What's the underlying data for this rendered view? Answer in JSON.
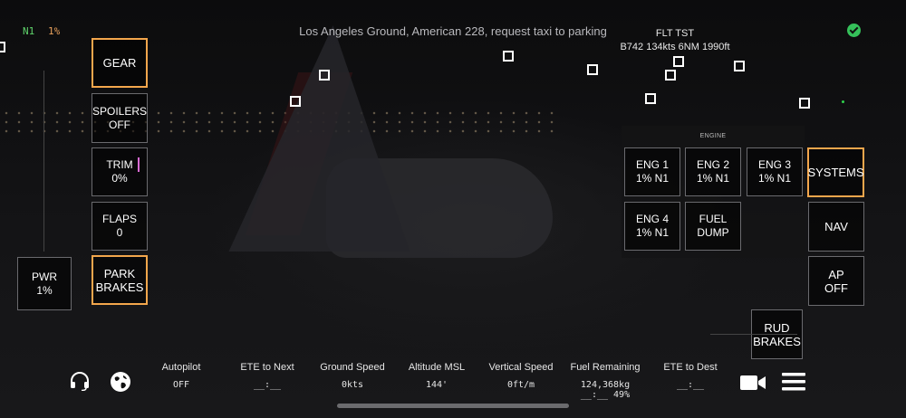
{
  "top": {
    "n1_label": "N1",
    "n1_value": "1%",
    "atc_message": "Los Angeles Ground, American 228, request taxi to parking",
    "flight_title": "FLT TST",
    "flight_info": "B742 134kts 6NM 1990ft",
    "status_icon": "check-circle-icon",
    "status_color": "#35c15a"
  },
  "left_controls": [
    {
      "id": "gear",
      "lines": [
        "GEAR"
      ],
      "active": true
    },
    {
      "id": "spoilers",
      "lines": [
        "SPOILERS",
        "OFF"
      ],
      "active": false
    },
    {
      "id": "trim",
      "lines": [
        "TRIM",
        "0%"
      ],
      "active": false
    },
    {
      "id": "flaps",
      "lines": [
        "FLAPS",
        "0"
      ],
      "active": false
    },
    {
      "id": "park-brakes",
      "lines": [
        "PARK",
        "BRAKES"
      ],
      "active": true
    }
  ],
  "power": {
    "lines": [
      "PWR",
      "1%"
    ]
  },
  "engine_panel": {
    "title": "ENGINE",
    "buttons": [
      {
        "id": "eng1",
        "lines": [
          "ENG 1",
          "1% N1"
        ]
      },
      {
        "id": "eng2",
        "lines": [
          "ENG 2",
          "1% N1"
        ]
      },
      {
        "id": "eng3",
        "lines": [
          "ENG 3",
          "1% N1"
        ]
      },
      {
        "id": "eng4",
        "lines": [
          "ENG 4",
          "1% N1"
        ]
      },
      {
        "id": "fuel-dump",
        "lines": [
          "FUEL",
          "DUMP"
        ]
      }
    ]
  },
  "right_controls": [
    {
      "id": "systems",
      "lines": [
        "SYSTEMS"
      ],
      "active": true
    },
    {
      "id": "nav",
      "lines": [
        "NAV"
      ],
      "active": false
    },
    {
      "id": "ap",
      "lines": [
        "AP",
        "OFF"
      ],
      "active": false
    },
    {
      "id": "rud-brakes",
      "lines": [
        "RUD",
        "BRAKES"
      ],
      "active": false
    }
  ],
  "hud": [
    {
      "id": "autopilot",
      "label": "Autopilot",
      "value": "OFF"
    },
    {
      "id": "ete-next",
      "label": "ETE to Next",
      "value": "__:__"
    },
    {
      "id": "ground-speed",
      "label": "Ground Speed",
      "value": "0kts"
    },
    {
      "id": "altitude",
      "label": "Altitude MSL",
      "value": "144'"
    },
    {
      "id": "vertical-speed",
      "label": "Vertical Speed",
      "value": "0ft/m"
    },
    {
      "id": "fuel",
      "label": "Fuel Remaining",
      "value": "124,368kg",
      "value2": "__:__ 49%"
    },
    {
      "id": "ete-dest",
      "label": "ETE to Dest",
      "value": "__:__"
    }
  ],
  "bottom_icons": {
    "left": [
      "headset-icon",
      "globe-icon"
    ],
    "right": [
      "camera-icon",
      "menu-icon"
    ]
  },
  "colors": {
    "accent": "#f3a64c",
    "trim_marker": "#d86bd2",
    "n1_green": "#5fd36b",
    "n1_orange": "#e9a15c"
  }
}
